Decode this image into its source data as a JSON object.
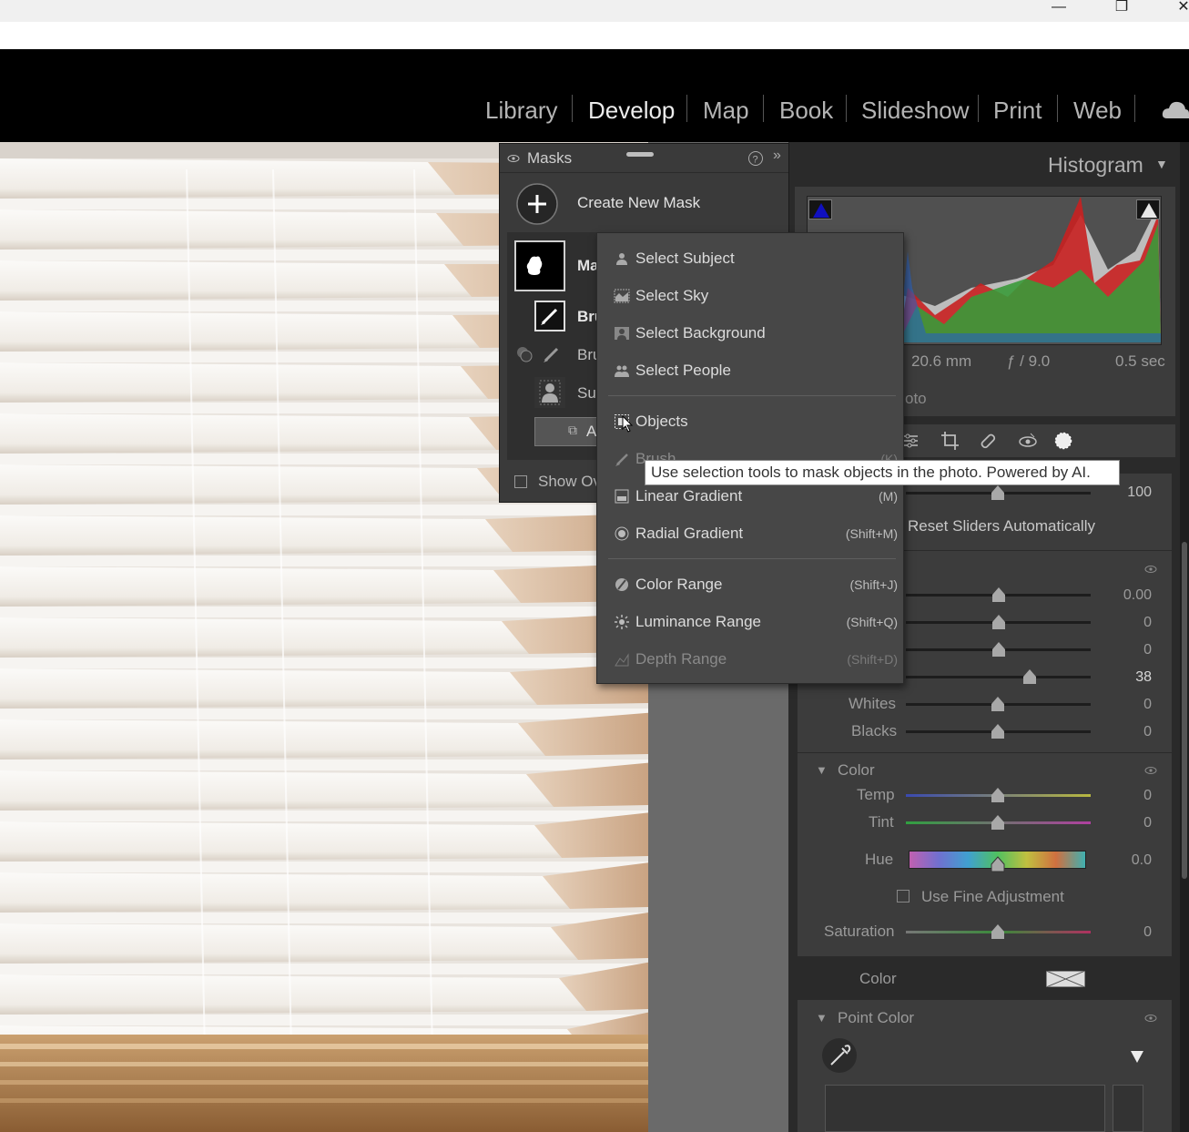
{
  "window": {
    "minimize_glyph": "—",
    "restore_glyph": "❐",
    "close_glyph": "✕"
  },
  "modules": [
    "Library",
    "Develop",
    "Map",
    "Book",
    "Slideshow",
    "Print",
    "Web"
  ],
  "active_module": "Develop",
  "masks_panel": {
    "title": "Masks",
    "create_label": "Create New Mask",
    "mask_name_partial": "Ma",
    "item1_partial": "Bru",
    "item2_partial": "Bru",
    "item3_partial": "Sul",
    "add_partial": "A",
    "show_overlay_partial": "Show Ov"
  },
  "mask_menu": {
    "items": [
      {
        "label": "Select Subject",
        "shortcut": "",
        "icon": "person-icon"
      },
      {
        "label": "Select Sky",
        "shortcut": "",
        "icon": "sky-icon"
      },
      {
        "label": "Select Background",
        "shortcut": "",
        "icon": "background-icon"
      },
      {
        "label": "Select People",
        "shortcut": "",
        "icon": "people-icon"
      },
      {
        "label": "Objects",
        "shortcut": "",
        "icon": "objects-icon"
      },
      {
        "label": "Brush",
        "shortcut": "(K)",
        "icon": "brush-icon"
      },
      {
        "label": "Linear Gradient",
        "shortcut": "(M)",
        "icon": "linear-gradient-icon"
      },
      {
        "label": "Radial Gradient",
        "shortcut": "(Shift+M)",
        "icon": "radial-gradient-icon"
      },
      {
        "label": "Color Range",
        "shortcut": "(Shift+J)",
        "icon": "color-range-icon"
      },
      {
        "label": "Luminance Range",
        "shortcut": "(Shift+Q)",
        "icon": "luminance-range-icon"
      },
      {
        "label": "Depth Range",
        "shortcut": "(Shift+D)",
        "icon": "depth-range-icon"
      }
    ]
  },
  "tooltip": "Use selection tools to mask objects in the photo. Powered by AI.",
  "histogram": {
    "title": "Histogram",
    "focal": "20.6 mm",
    "aperture": "ƒ / 9.0",
    "shutter": "0.5 sec",
    "original_partial": "oto"
  },
  "amount_value": "100",
  "reset_sliders": "Reset Sliders Automatically",
  "light": {
    "values": [
      "0.00",
      "0",
      "0",
      "38"
    ],
    "slider_positions": [
      0.5,
      0.5,
      0.5,
      0.67
    ],
    "whites_label": "Whites",
    "whites_value": "0",
    "blacks_label": "Blacks",
    "blacks_value": "0"
  },
  "color_section": {
    "title": "Color",
    "temp_label": "Temp",
    "temp_value": "0",
    "tint_label": "Tint",
    "tint_value": "0",
    "hue_label": "Hue",
    "hue_value": "0.0",
    "fine_label": "Use Fine Adjustment",
    "sat_label": "Saturation",
    "sat_value": "0",
    "color_label": "Color"
  },
  "point_color": {
    "title": "Point Color"
  },
  "colors": {
    "accent": "#0000a0",
    "panel": "#3c3c3c",
    "menu": "#474747"
  }
}
